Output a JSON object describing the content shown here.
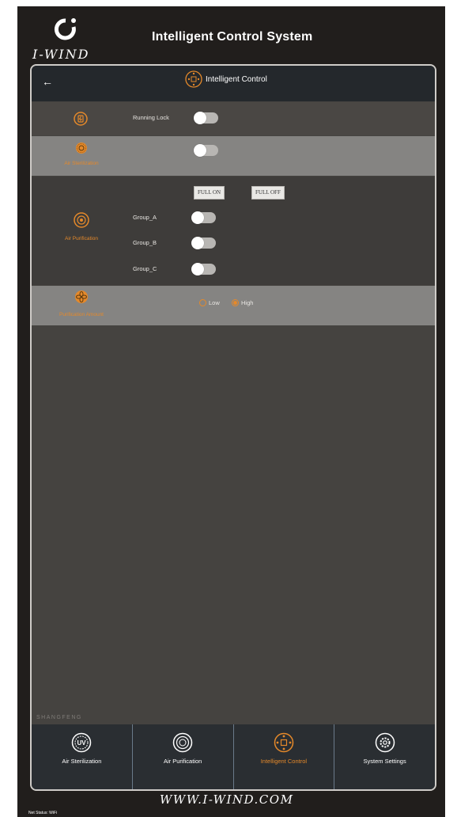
{
  "brand": {
    "logo_text": "I-WIND"
  },
  "app": {
    "title": "Intelligent Control System"
  },
  "topbar": {
    "back_icon": "back-arrow-icon",
    "title": "Intelligent Control",
    "title_icon": "intelligent-control-icon"
  },
  "rows": {
    "running_lock": {
      "icon": "lock-icon",
      "label": "Running Lock",
      "state": "off"
    },
    "air_sterilization": {
      "icon": "sterilization-icon",
      "label": "Air Sterilization",
      "state": "off"
    },
    "air_purification": {
      "icon": "purification-icon",
      "label": "Air Purification",
      "full_on": "FULL ON",
      "full_off": "FULL OFF",
      "groups": [
        {
          "label": "Group_A",
          "state": "off"
        },
        {
          "label": "Group_B",
          "state": "off"
        },
        {
          "label": "Group_C",
          "state": "off"
        }
      ]
    },
    "purification_amount": {
      "icon": "fan-icon",
      "label": "Purification Amount",
      "options": [
        "Low",
        "High"
      ],
      "selected": "High"
    }
  },
  "watermark": "SHANGFENG",
  "nav": {
    "items": [
      {
        "label": "Air Sterilization",
        "icon": "uv-icon",
        "active": false
      },
      {
        "label": "Air Purification",
        "icon": "purification-icon",
        "active": false
      },
      {
        "label": "Intelligent Control",
        "icon": "intelligent-control-icon",
        "active": true
      },
      {
        "label": "System Settings",
        "icon": "gear-icon",
        "active": false
      }
    ]
  },
  "footer": {
    "website": "WWW.I-WIND.COM",
    "status": "Net Status: WiFi"
  },
  "colors": {
    "accent": "#e5892a",
    "background": "#211e1c",
    "panel": "#454340",
    "topbar": "#24282c"
  }
}
